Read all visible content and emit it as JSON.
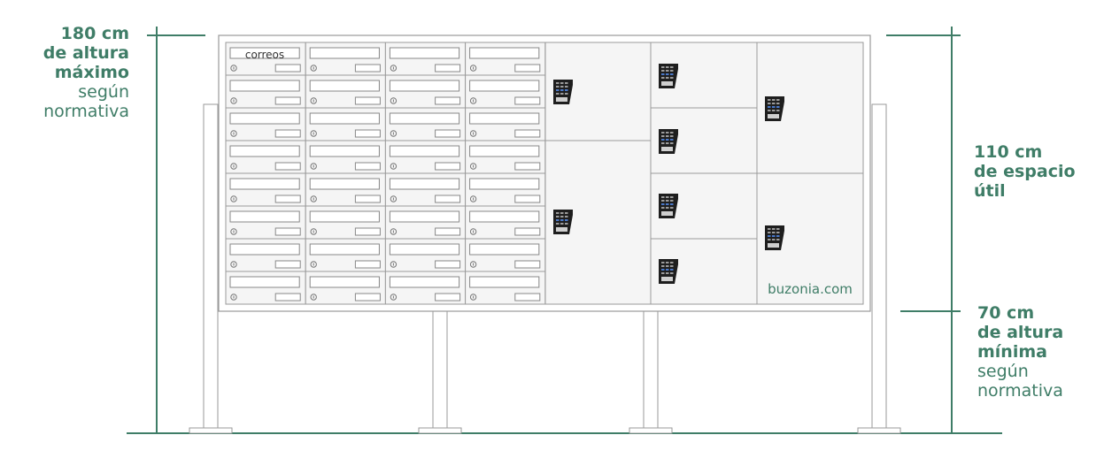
{
  "annotations": {
    "max_height": {
      "line1": "180 cm",
      "line2": "de altura",
      "line3": "máximo",
      "line4": "según",
      "line5": "normativa"
    },
    "useful_space": {
      "line1": "110 cm",
      "line2": "de espacio",
      "line3": "útil"
    },
    "min_height": {
      "line1": "70 cm",
      "line2": "de altura",
      "line3": "mínima",
      "line4": "según",
      "line5": "normativa"
    }
  },
  "mailbox": {
    "first_slot_label": "correos",
    "brand": "buzonia.com",
    "mail_columns": 4,
    "mail_rows": 8
  },
  "colors": {
    "accent": "#3f7d67",
    "outline": "#9a9a9a",
    "panel": "#f5f5f5",
    "keypad": "#1e1e1e"
  }
}
